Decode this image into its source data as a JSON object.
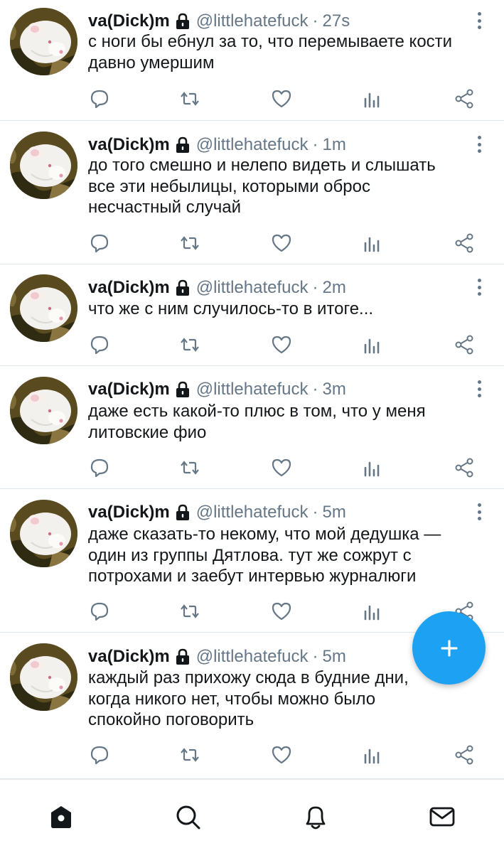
{
  "author": {
    "name": "va(Dick)m",
    "handle": "@littlehatefuck"
  },
  "tweets": [
    {
      "time": "27s",
      "lines": [
        "с ноги бы ебнул за то, что перемываете кости",
        "давно умершим"
      ]
    },
    {
      "time": "1m",
      "lines": [
        "до того смешно и нелепо видеть и слышать",
        "все эти небылицы, которыми оброс",
        "несчастный случай"
      ]
    },
    {
      "time": "2m",
      "lines": [
        "что же с ним случилось-то в итоге..."
      ]
    },
    {
      "time": "3m",
      "lines": [
        "даже есть какой-то плюс в том, что у меня",
        "литовские фио"
      ]
    },
    {
      "time": "5m",
      "lines": [
        "даже сказать-то некому, что мой дедушка —",
        "один из группы Дятлова. тут же сожрут с",
        "потрохами и заебут интервью журналюги"
      ]
    },
    {
      "time": "5m",
      "lines": [
        "каждый раз прихожу сюда в будние дни,",
        "когда никого нет, чтобы можно было",
        "спокойно поговорить"
      ]
    }
  ],
  "icons": {
    "actions": [
      "reply-icon",
      "retweet-icon",
      "like-icon",
      "analytics-icon",
      "share-icon"
    ],
    "nav": [
      "home-icon",
      "search-icon",
      "notifications-icon",
      "messages-icon"
    ],
    "fab": "compose-plus-icon"
  },
  "colors": {
    "accent": "#1da1f2",
    "icon_gray": "#657786",
    "text": "#14171a",
    "divider": "#e1e8ed"
  },
  "dot": "·"
}
